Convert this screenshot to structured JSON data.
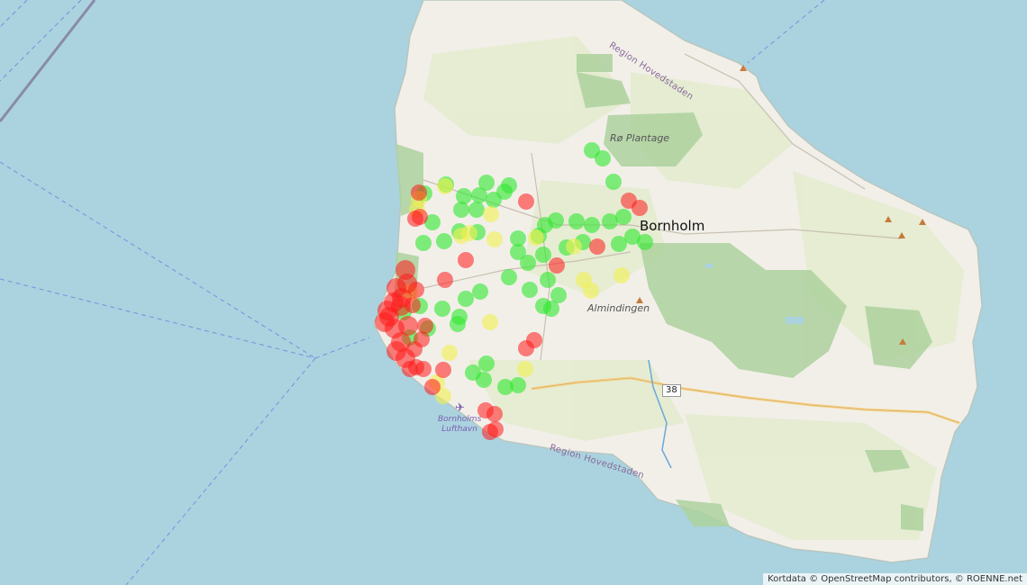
{
  "labels": {
    "island": "Bornholm",
    "forest_north": "Rø Plantage",
    "forest_center": "Almindingen",
    "region_north": "Region Hovedstaden",
    "region_south": "Region Hovedstaden",
    "airport_line1": "Bornholms",
    "airport_line2": "Lufthavn",
    "road_number": "38"
  },
  "attribution": "Kortdata © OpenStreetMap contributors, © ROENNE.net",
  "colors": {
    "sea": "#aad3df",
    "land": "#f2efe9",
    "field": "#e4ecd0",
    "forest": "#add19e",
    "marker_red": "#ff1a1a",
    "marker_yellow": "#f0f050",
    "marker_green": "#2fe82f"
  }
}
